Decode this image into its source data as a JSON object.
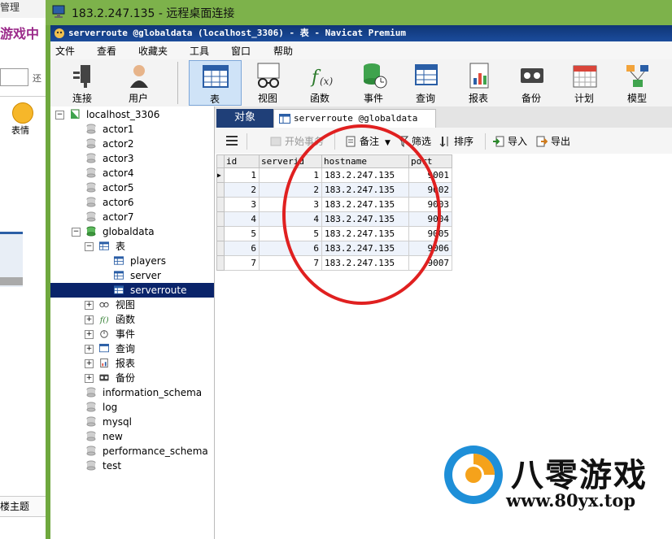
{
  "background_window": {
    "title_fragment": "管理",
    "pink_text": "游戏中",
    "input_suffix": "还",
    "emoji_label": "表情",
    "bottom_text": "楼主题"
  },
  "rdp_title": "183.2.247.135 - 远程桌面连接",
  "navicat_title": "serverroute @globaldata (localhost_3306) - 表 - Navicat Premium",
  "menu": [
    "文件",
    "查看",
    "收藏夹",
    "工具",
    "窗口",
    "帮助"
  ],
  "toolbar": {
    "connect": "连接",
    "user": "用户",
    "table": "表",
    "view": "视图",
    "function": "函数",
    "event": "事件",
    "query": "查询",
    "report": "报表",
    "backup": "备份",
    "schedule": "计划",
    "model": "模型"
  },
  "tree": {
    "connection": "localhost_3306",
    "actors": [
      "actor1",
      "actor2",
      "actor3",
      "actor4",
      "actor5",
      "actor6",
      "actor7"
    ],
    "globaldata": "globaldata",
    "tables_label": "表",
    "tables": [
      "players",
      "server",
      "serverroute"
    ],
    "subnodes": [
      "视图",
      "函数",
      "事件",
      "查询",
      "报表",
      "备份"
    ],
    "other_dbs": [
      "information_schema",
      "log",
      "mysql",
      "new",
      "performance_schema",
      "test"
    ]
  },
  "tabs": {
    "objects": "对象",
    "current": "serverroute @globaldata (..."
  },
  "grid_toolbar": {
    "begin_transaction": "开始事务",
    "memo": "备注",
    "filter": "筛选",
    "sort": "排序",
    "import": "导入",
    "export": "导出"
  },
  "table": {
    "columns": [
      "id",
      "serverid",
      "hostname",
      "port"
    ],
    "rows": [
      [
        "1",
        "1",
        "183.2.247.135",
        "9001"
      ],
      [
        "2",
        "2",
        "183.2.247.135",
        "9002"
      ],
      [
        "3",
        "3",
        "183.2.247.135",
        "9003"
      ],
      [
        "4",
        "4",
        "183.2.247.135",
        "9004"
      ],
      [
        "5",
        "5",
        "183.2.247.135",
        "9005"
      ],
      [
        "6",
        "6",
        "183.2.247.135",
        "9006"
      ],
      [
        "7",
        "7",
        "183.2.247.135",
        "9007"
      ]
    ]
  },
  "watermark": {
    "title": "八零游戏",
    "url": "www.80yx.top"
  },
  "colors": {
    "rdp_green": "#7db24b",
    "navicat_blue": "#0f3576",
    "highlight_circle": "#e02020"
  }
}
